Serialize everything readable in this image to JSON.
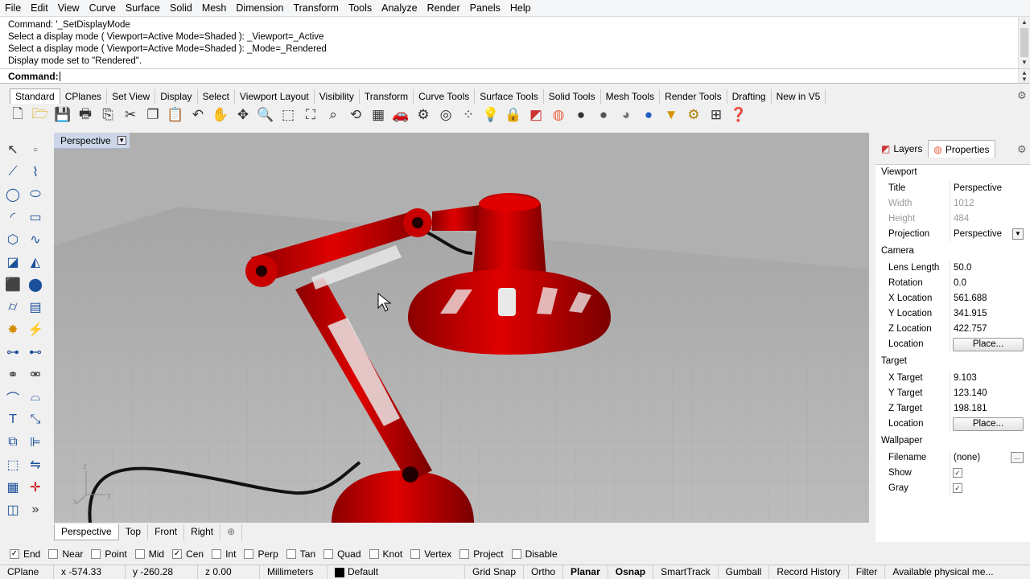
{
  "menu": [
    "File",
    "Edit",
    "View",
    "Curve",
    "Surface",
    "Solid",
    "Mesh",
    "Dimension",
    "Transform",
    "Tools",
    "Analyze",
    "Render",
    "Panels",
    "Help"
  ],
  "command_history": [
    "Command: '_SetDisplayMode",
    "Select a display mode ( Viewport=Active  Mode=Shaded ): _Viewport=_Active",
    "Select a display mode ( Viewport=Active  Mode=Shaded ): _Mode=_Rendered",
    "Display mode set to \"Rendered\"."
  ],
  "command_prompt": "Command:",
  "toolbar_tabs": [
    "Standard",
    "CPlanes",
    "Set View",
    "Display",
    "Select",
    "Viewport Layout",
    "Visibility",
    "Transform",
    "Curve Tools",
    "Surface Tools",
    "Solid Tools",
    "Mesh Tools",
    "Render Tools",
    "Drafting",
    "New in V5"
  ],
  "toolbar_icons": [
    "new",
    "open",
    "save",
    "print",
    "import",
    "cut",
    "copy",
    "paste",
    "undo",
    "pan",
    "rotate-view",
    "zoom",
    "zoom-window",
    "zoom-extents",
    "zoom-selected",
    "rotate-3d",
    "grid",
    "car",
    "settings-view",
    "target",
    "snap-points",
    "lightbulb",
    "lock",
    "layer",
    "color-wheel",
    "sphere",
    "matte-sphere",
    "shaded-sphere",
    "render-sphere",
    "arrow-down",
    "gears",
    "cage",
    "help"
  ],
  "viewport": {
    "title": "Perspective",
    "tabs": [
      "Perspective",
      "Top",
      "Front",
      "Right"
    ],
    "add_tab": "⊕",
    "axis_labels": {
      "z": "z",
      "y": "y",
      "x": "x"
    }
  },
  "panel": {
    "tabs": [
      "Layers",
      "Properties"
    ],
    "sections": {
      "viewport": "Viewport",
      "camera": "Camera",
      "target": "Target",
      "wallpaper": "Wallpaper"
    },
    "title_label": "Title",
    "title_value": "Perspective",
    "width_label": "Width",
    "width_value": "1012",
    "height_label": "Height",
    "height_value": "484",
    "projection_label": "Projection",
    "projection_value": "Perspective",
    "lens_label": "Lens Length",
    "lens_value": "50.0",
    "rotation_label": "Rotation",
    "rotation_value": "0.0",
    "xloc_label": "X Location",
    "xloc_value": "561.688",
    "yloc_label": "Y Location",
    "yloc_value": "341.915",
    "zloc_label": "Z Location",
    "zloc_value": "422.757",
    "cam_location_label": "Location",
    "place_button": "Place...",
    "xtgt_label": "X Target",
    "xtgt_value": "9.103",
    "ytgt_label": "Y Target",
    "ytgt_value": "123.140",
    "ztgt_label": "Z Target",
    "ztgt_value": "198.181",
    "tgt_location_label": "Location",
    "filename_label": "Filename",
    "filename_value": "(none)",
    "browse_button": "...",
    "show_label": "Show",
    "gray_label": "Gray"
  },
  "osnaps": [
    {
      "label": "End",
      "checked": true
    },
    {
      "label": "Near",
      "checked": false
    },
    {
      "label": "Point",
      "checked": false
    },
    {
      "label": "Mid",
      "checked": false
    },
    {
      "label": "Cen",
      "checked": true
    },
    {
      "label": "Int",
      "checked": false
    },
    {
      "label": "Perp",
      "checked": false
    },
    {
      "label": "Tan",
      "checked": false
    },
    {
      "label": "Quad",
      "checked": false
    },
    {
      "label": "Knot",
      "checked": false
    },
    {
      "label": "Vertex",
      "checked": false
    },
    {
      "label": "Project",
      "checked": false
    },
    {
      "label": "Disable",
      "checked": false
    }
  ],
  "status": {
    "cplane": "CPlane",
    "x": "x -574.33",
    "y": "y -260.28",
    "z": "z 0.00",
    "units": "Millimeters",
    "layer": "Default",
    "grid_snap": "Grid Snap",
    "ortho": "Ortho",
    "planar": "Planar",
    "osnap": "Osnap",
    "smarttrack": "SmartTrack",
    "gumball": "Gumball",
    "record_history": "Record History",
    "filter": "Filter",
    "message": "Available physical me..."
  },
  "colors": {
    "lamp_red": "#d40000",
    "viewport_bg": "#b3b3b3",
    "title_bg": "#cbd6e8"
  }
}
